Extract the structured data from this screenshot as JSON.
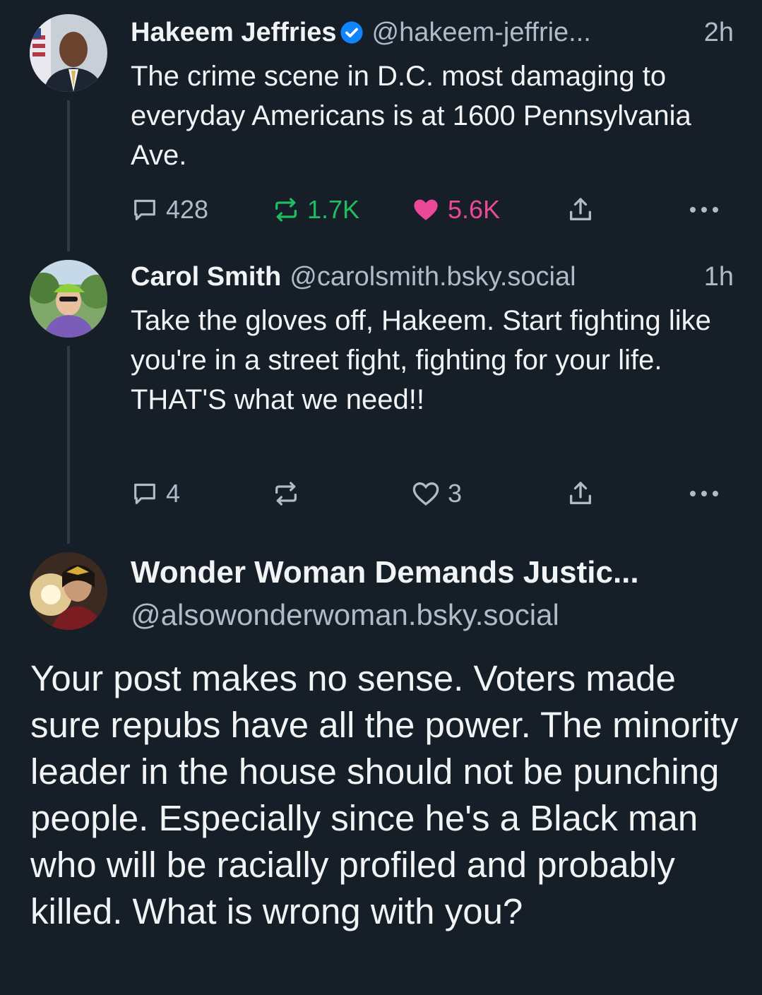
{
  "thread": [
    {
      "name": "Hakeem Jeffries",
      "verified": true,
      "handle": "@hakeem-jeffrie...",
      "time": "2h",
      "text": "The crime scene in D.C. most damaging to everyday Americans is at 1600 Pennsylvania Ave.",
      "replies": "428",
      "reposts": "1.7K",
      "likes": "5.6K",
      "reposted": true,
      "liked": true
    },
    {
      "name": "Carol Smith",
      "verified": false,
      "handle": "@carolsmith.bsky.social",
      "time": "1h",
      "text": "Take the gloves off, Hakeem. Start fighting like you're in a street fight, fighting for your life. THAT'S what we need!!",
      "replies": "4",
      "reposts": "",
      "likes": "3",
      "reposted": false,
      "liked": false
    }
  ],
  "main_post": {
    "name": "Wonder Woman Demands Justic...",
    "handle": "@alsowonderwoman.bsky.social",
    "text": "Your post makes no sense. Voters made sure repubs have all the power. The minority leader in the house should not be punching people. Especially since he's a Black man who will be racially profiled and probably killed. What is wrong with you?"
  },
  "colors": {
    "background": "#161e27",
    "text": "#f1f3f5",
    "muted": "#aebbc9",
    "verified": "#1083fe",
    "repost_active": "#20bc62",
    "like_active": "#ec4899",
    "thread_line": "#2e3a48"
  },
  "icons": [
    "verified-badge-icon",
    "reply-icon",
    "repost-icon",
    "heart-icon",
    "share-icon",
    "more-icon"
  ]
}
